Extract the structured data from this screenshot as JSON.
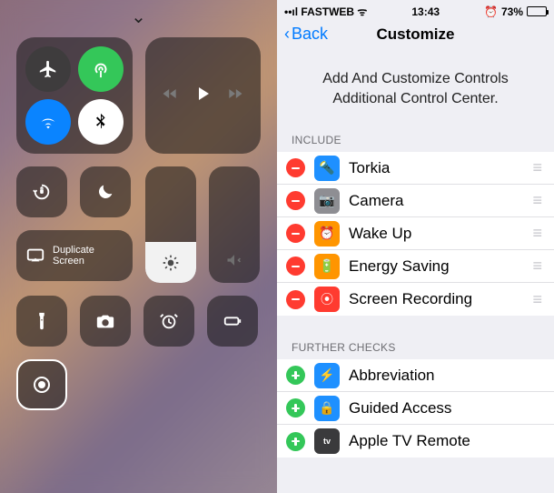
{
  "control_center": {
    "connectivity": {
      "airplane": "airplane-icon",
      "airdrop": "airdrop-icon",
      "wifi": "wifi-icon",
      "bluetooth": "bluetooth-icon"
    },
    "orientation_lock": "orientation-lock-icon",
    "dnd": "moon-icon",
    "brightness_pct": 35,
    "volume_pct": 0,
    "screen_mirror": {
      "line1": "Duplicate",
      "line2": "Screen"
    },
    "shortcuts": {
      "flashlight": "flashlight-icon",
      "camera": "camera-icon",
      "alarm": "alarm-icon",
      "low_power": "battery-icon",
      "record": "record-icon"
    }
  },
  "status_bar": {
    "carrier": "FASTWEB",
    "time": "13:43",
    "alarm": true,
    "battery_pct": "73%",
    "battery_level": 73
  },
  "nav": {
    "back": "Back",
    "title": "Customize"
  },
  "description": "Add And Customize Controls Additional Control Center.",
  "sections": {
    "include_header": "INCLUDE",
    "further_header": "FURTHER CHECKS"
  },
  "include": [
    {
      "label": "Torkia",
      "icon_color": "blue",
      "glyph": "🔦"
    },
    {
      "label": "Camera",
      "icon_color": "gray",
      "glyph": "📷"
    },
    {
      "label": "Wake Up",
      "icon_color": "orange",
      "glyph": "⏰"
    },
    {
      "label": "Energy Saving",
      "icon_color": "orange",
      "glyph": "🔋"
    },
    {
      "label": "Screen Recording",
      "icon_color": "red",
      "glyph": "⦿"
    }
  ],
  "further": [
    {
      "label": "Abbreviation",
      "icon_color": "blue",
      "glyph": "⚡"
    },
    {
      "label": "Guided Access",
      "icon_color": "blue",
      "glyph": "🔒"
    },
    {
      "label": "Apple TV Remote",
      "icon_color": "dark",
      "glyph": "tv"
    }
  ]
}
